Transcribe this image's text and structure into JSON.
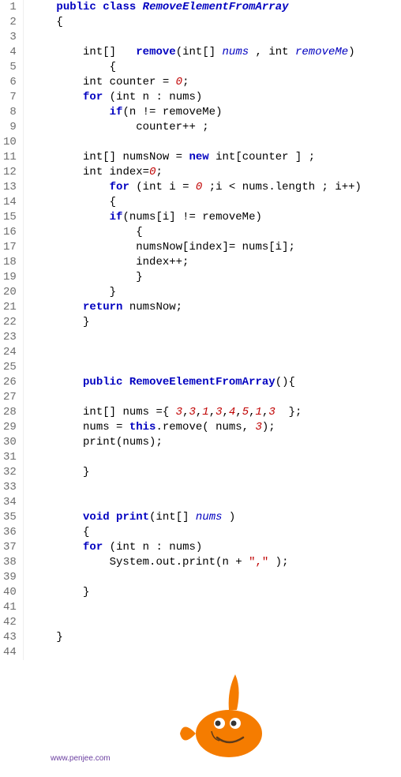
{
  "footer": "www.penjee.com",
  "lines": [
    {
      "n": 1,
      "segs": [
        {
          "t": "    "
        },
        {
          "t": "public",
          "c": "kw"
        },
        {
          "t": " "
        },
        {
          "t": "class",
          "c": "kw"
        },
        {
          "t": " "
        },
        {
          "t": "RemoveElementFromArray",
          "c": "cls"
        }
      ]
    },
    {
      "n": 2,
      "segs": [
        {
          "t": "    {"
        }
      ]
    },
    {
      "n": 3,
      "segs": [
        {
          "t": ""
        }
      ]
    },
    {
      "n": 4,
      "segs": [
        {
          "t": "        "
        },
        {
          "t": "int",
          "c": "type"
        },
        {
          "t": "[]   "
        },
        {
          "t": "remove",
          "c": "meth"
        },
        {
          "t": "("
        },
        {
          "t": "int",
          "c": "type"
        },
        {
          "t": "[] "
        },
        {
          "t": "nums",
          "c": "param"
        },
        {
          "t": " , "
        },
        {
          "t": "int",
          "c": "type"
        },
        {
          "t": " "
        },
        {
          "t": "removeMe",
          "c": "param"
        },
        {
          "t": ")"
        }
      ]
    },
    {
      "n": 5,
      "segs": [
        {
          "t": "            {"
        }
      ]
    },
    {
      "n": 6,
      "segs": [
        {
          "t": "        "
        },
        {
          "t": "int",
          "c": "type"
        },
        {
          "t": " counter = "
        },
        {
          "t": "0",
          "c": "num"
        },
        {
          "t": ";"
        }
      ]
    },
    {
      "n": 7,
      "segs": [
        {
          "t": "        "
        },
        {
          "t": "for",
          "c": "kw"
        },
        {
          "t": " ("
        },
        {
          "t": "int",
          "c": "type"
        },
        {
          "t": " n : nums)"
        }
      ]
    },
    {
      "n": 8,
      "segs": [
        {
          "t": "            "
        },
        {
          "t": "if",
          "c": "kw"
        },
        {
          "t": "(n != removeMe)"
        }
      ]
    },
    {
      "n": 9,
      "segs": [
        {
          "t": "                counter++ ;"
        }
      ]
    },
    {
      "n": 10,
      "segs": [
        {
          "t": ""
        }
      ]
    },
    {
      "n": 11,
      "segs": [
        {
          "t": "        "
        },
        {
          "t": "int",
          "c": "type"
        },
        {
          "t": "[] numsNow = "
        },
        {
          "t": "new",
          "c": "kw"
        },
        {
          "t": " "
        },
        {
          "t": "int",
          "c": "type"
        },
        {
          "t": "[counter ] ;"
        }
      ]
    },
    {
      "n": 12,
      "segs": [
        {
          "t": "        "
        },
        {
          "t": "int",
          "c": "type"
        },
        {
          "t": " index="
        },
        {
          "t": "0",
          "c": "num"
        },
        {
          "t": ";"
        }
      ]
    },
    {
      "n": 13,
      "segs": [
        {
          "t": "            "
        },
        {
          "t": "for",
          "c": "kw"
        },
        {
          "t": " ("
        },
        {
          "t": "int",
          "c": "type"
        },
        {
          "t": " i = "
        },
        {
          "t": "0",
          "c": "num"
        },
        {
          "t": " ;i < nums.length ; i++)"
        }
      ]
    },
    {
      "n": 14,
      "segs": [
        {
          "t": "            {"
        }
      ]
    },
    {
      "n": 15,
      "segs": [
        {
          "t": "            "
        },
        {
          "t": "if",
          "c": "kw"
        },
        {
          "t": "(nums[i] != removeMe)"
        }
      ]
    },
    {
      "n": 16,
      "segs": [
        {
          "t": "                {"
        }
      ]
    },
    {
      "n": 17,
      "segs": [
        {
          "t": "                numsNow[index]= nums[i];"
        }
      ]
    },
    {
      "n": 18,
      "segs": [
        {
          "t": "                index++;"
        }
      ]
    },
    {
      "n": 19,
      "segs": [
        {
          "t": "                }"
        }
      ]
    },
    {
      "n": 20,
      "segs": [
        {
          "t": "            }"
        }
      ]
    },
    {
      "n": 21,
      "segs": [
        {
          "t": "        "
        },
        {
          "t": "return",
          "c": "kw"
        },
        {
          "t": " numsNow;"
        }
      ]
    },
    {
      "n": 22,
      "segs": [
        {
          "t": "        }"
        }
      ]
    },
    {
      "n": 23,
      "segs": [
        {
          "t": ""
        }
      ]
    },
    {
      "n": 24,
      "segs": [
        {
          "t": ""
        }
      ]
    },
    {
      "n": 25,
      "segs": [
        {
          "t": ""
        }
      ]
    },
    {
      "n": 26,
      "segs": [
        {
          "t": "        "
        },
        {
          "t": "public",
          "c": "kw"
        },
        {
          "t": " "
        },
        {
          "t": "RemoveElementFromArray",
          "c": "meth"
        },
        {
          "t": "(){"
        }
      ]
    },
    {
      "n": 27,
      "segs": [
        {
          "t": ""
        }
      ]
    },
    {
      "n": 28,
      "segs": [
        {
          "t": "        "
        },
        {
          "t": "int",
          "c": "type"
        },
        {
          "t": "[] nums ={ "
        },
        {
          "t": "3",
          "c": "num"
        },
        {
          "t": ","
        },
        {
          "t": "3",
          "c": "num"
        },
        {
          "t": ","
        },
        {
          "t": "1",
          "c": "num"
        },
        {
          "t": ","
        },
        {
          "t": "3",
          "c": "num"
        },
        {
          "t": ","
        },
        {
          "t": "4",
          "c": "num"
        },
        {
          "t": ","
        },
        {
          "t": "5",
          "c": "num"
        },
        {
          "t": ","
        },
        {
          "t": "1",
          "c": "num"
        },
        {
          "t": ","
        },
        {
          "t": "3",
          "c": "num"
        },
        {
          "t": "  };"
        }
      ]
    },
    {
      "n": 29,
      "segs": [
        {
          "t": "        nums = "
        },
        {
          "t": "this",
          "c": "kw"
        },
        {
          "t": ".remove( nums, "
        },
        {
          "t": "3",
          "c": "num"
        },
        {
          "t": ");"
        }
      ]
    },
    {
      "n": 30,
      "segs": [
        {
          "t": "        print(nums);"
        }
      ]
    },
    {
      "n": 31,
      "segs": [
        {
          "t": ""
        }
      ]
    },
    {
      "n": 32,
      "segs": [
        {
          "t": "        }"
        }
      ]
    },
    {
      "n": 33,
      "segs": [
        {
          "t": ""
        }
      ]
    },
    {
      "n": 34,
      "segs": [
        {
          "t": ""
        }
      ]
    },
    {
      "n": 35,
      "segs": [
        {
          "t": "        "
        },
        {
          "t": "void",
          "c": "kw"
        },
        {
          "t": " "
        },
        {
          "t": "print",
          "c": "meth"
        },
        {
          "t": "("
        },
        {
          "t": "int",
          "c": "type"
        },
        {
          "t": "[] "
        },
        {
          "t": "nums",
          "c": "param"
        },
        {
          "t": " )"
        }
      ]
    },
    {
      "n": 36,
      "segs": [
        {
          "t": "        {"
        }
      ]
    },
    {
      "n": 37,
      "segs": [
        {
          "t": "        "
        },
        {
          "t": "for",
          "c": "kw"
        },
        {
          "t": " ("
        },
        {
          "t": "int",
          "c": "type"
        },
        {
          "t": " n : nums)"
        }
      ]
    },
    {
      "n": 38,
      "segs": [
        {
          "t": "            System.out.print(n + "
        },
        {
          "t": "\",\"",
          "c": "str"
        },
        {
          "t": " );"
        }
      ]
    },
    {
      "n": 39,
      "segs": [
        {
          "t": ""
        }
      ]
    },
    {
      "n": 40,
      "segs": [
        {
          "t": "        }"
        }
      ]
    },
    {
      "n": 41,
      "segs": [
        {
          "t": ""
        }
      ]
    },
    {
      "n": 42,
      "segs": [
        {
          "t": ""
        }
      ]
    },
    {
      "n": 43,
      "segs": [
        {
          "t": "    }"
        }
      ]
    },
    {
      "n": 44,
      "segs": [
        {
          "t": ""
        }
      ]
    }
  ]
}
